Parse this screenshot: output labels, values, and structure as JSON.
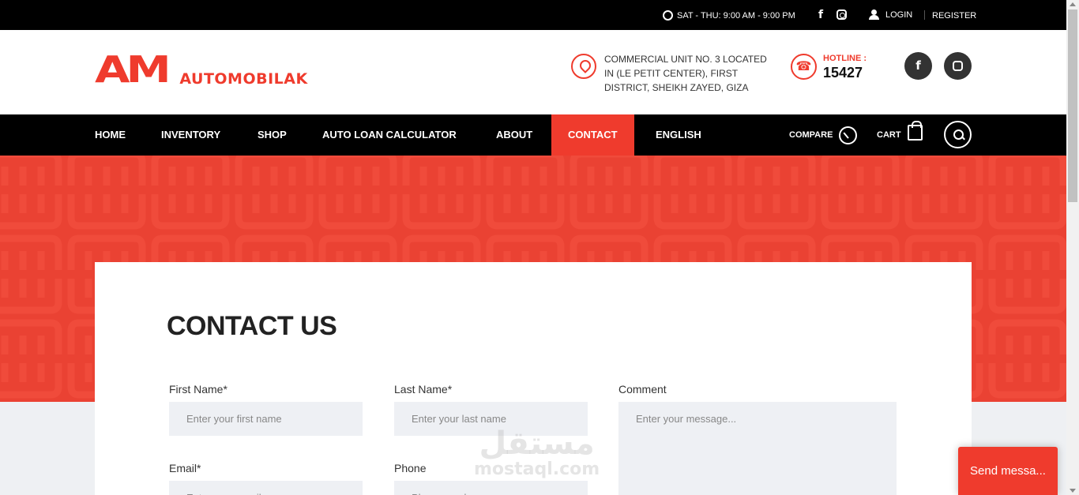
{
  "topbar": {
    "hours": "SAT - THU: 9:00 AM - 9:00 PM",
    "login": "LOGIN",
    "register": "REGISTER"
  },
  "header": {
    "logo_mark": "AM",
    "logo_text": "AUTOMOBILAK",
    "address": "COMMERCIAL UNIT NO. 3 LOCATED IN (LE PETIT CENTER), FIRST DISTRICT, SHEIKH ZAYED, GIZA",
    "hotline_label": "HOTLINE :",
    "hotline_number": "15427",
    "facebook_glyph": "f"
  },
  "nav": {
    "items": [
      "HOME",
      "INVENTORY",
      "SHOP",
      "AUTO LOAN CALCULATOR",
      "ABOUT",
      "CONTACT",
      "ENGLISH"
    ],
    "active": "CONTACT",
    "compare": "COMPARE",
    "cart": "CART"
  },
  "contact": {
    "title": "CONTACT US",
    "first_name_label": "First Name*",
    "first_name_placeholder": "Enter your first name",
    "last_name_label": "Last Name*",
    "last_name_placeholder": "Enter your last name",
    "comment_label": "Comment",
    "comment_placeholder": "Enter your message...",
    "email_label": "Email*",
    "email_placeholder": "Enter your email",
    "phone_label": "Phone",
    "phone_placeholder": "Phone number"
  },
  "watermark": {
    "arabic": "مستقل",
    "latin": "mostaql.com"
  },
  "chat": {
    "label": "Send messa..."
  },
  "colors": {
    "accent": "#ef3b2d",
    "dark": "#000000",
    "input_bg": "#eef0f4"
  }
}
